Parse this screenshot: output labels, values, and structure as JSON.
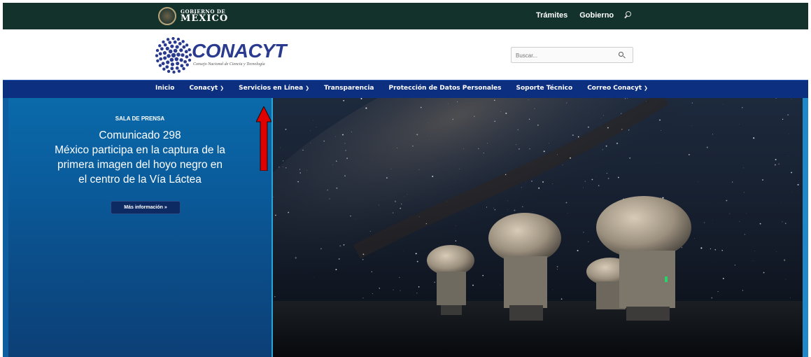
{
  "gov": {
    "line1": "GOBIERNO DE",
    "line2": "MÉXICO",
    "links": [
      "Trámites",
      "Gobierno"
    ],
    "search_icon": "search-icon"
  },
  "brand": {
    "name": "CONACYT",
    "subtitle": "Consejo Nacional de Ciencia y Tecnología"
  },
  "search": {
    "placeholder": "Buscar...",
    "icon": "search-icon"
  },
  "nav": {
    "items": [
      {
        "label": "Inicio",
        "dropdown": false
      },
      {
        "label": "Conacyt",
        "dropdown": true
      },
      {
        "label": "Servicios en Línea",
        "dropdown": true
      },
      {
        "label": "Transparencia",
        "dropdown": false
      },
      {
        "label": "Protección de Datos Personales",
        "dropdown": false
      },
      {
        "label": "Soporte Técnico",
        "dropdown": false
      },
      {
        "label": "Correo Conacyt",
        "dropdown": true
      }
    ]
  },
  "hero": {
    "kicker": "SALA DE PRENSA",
    "headline_line1": "Comunicado 298",
    "headline_line2": "México participa en la captura de la",
    "headline_line3": "primera imagen del hoyo negro en",
    "headline_line4": "el centro de la Vía Láctea",
    "button": "Más información »"
  },
  "annotation": {
    "arrow_color": "#e00000",
    "icon": "arrow-up-icon"
  },
  "colors": {
    "gov_bar": "#13322b",
    "nav_bar": "#0c2f80",
    "brand_blue": "#2a3b8f",
    "hero_panel": "#0a5d9d"
  }
}
